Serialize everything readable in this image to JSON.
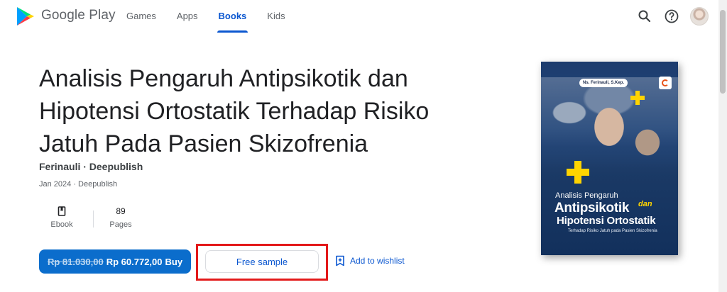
{
  "header": {
    "brand": "Google Play",
    "nav": [
      {
        "label": "Games",
        "active": false
      },
      {
        "label": "Apps",
        "active": false
      },
      {
        "label": "Books",
        "active": true
      },
      {
        "label": "Kids",
        "active": false
      }
    ],
    "icons": [
      "search-icon",
      "help-icon",
      "avatar"
    ],
    "accent_color": "#0b57d0"
  },
  "book": {
    "title": "Analisis Pengaruh Antipsikotik dan Hipotensi Ortostatik Terhadap Risiko Jatuh Pada Pasien Skizofrenia",
    "byline": "Ferinauli · Deepublish",
    "pub_date": "Jan 2024 · Deepublish",
    "format": {
      "label": "Ebook",
      "icon": "book-icon"
    },
    "pages": {
      "value": "89",
      "label": "Pages"
    }
  },
  "actions": {
    "original_price": "Rp 81.030,00",
    "sale_price": "Rp 60.772,00",
    "buy_label": "Buy",
    "sample_label": "Free sample",
    "wishlist_label": "Add to wishlist",
    "highlight_color": "#e3191a"
  },
  "cover": {
    "author": "Ns. Ferinauli, S.Kep.",
    "line1": "Analisis Pengaruh",
    "line2": "Antipsikotik",
    "conjunction": "dan",
    "line3": "Hipotensi Ortostatik",
    "line4": "Terhadap Risiko Jatuh pada Pasien Skizofrenia"
  }
}
